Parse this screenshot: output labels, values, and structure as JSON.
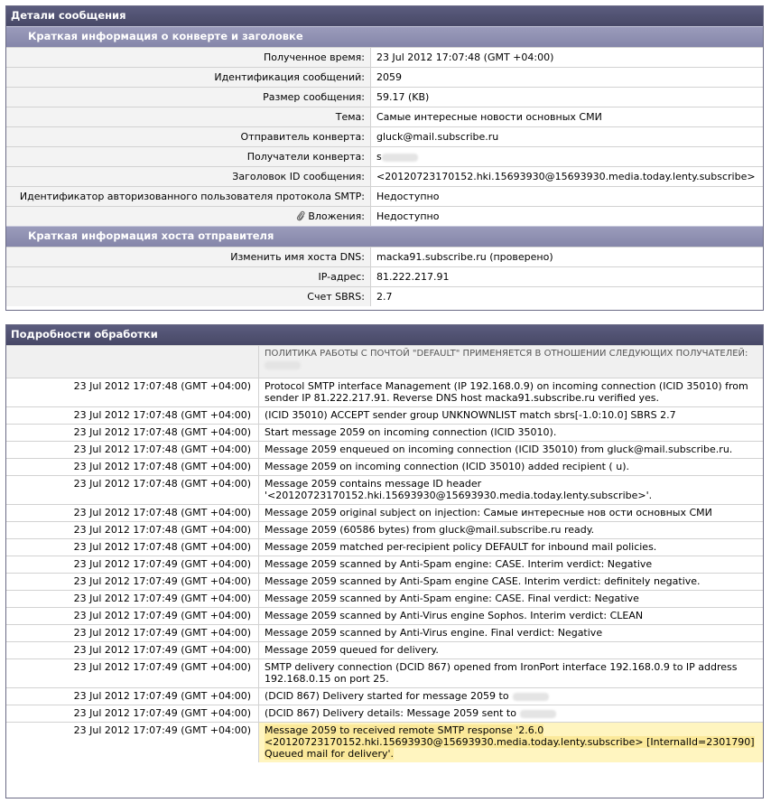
{
  "details": {
    "title": "Детали сообщения",
    "envelope_section": "Краткая информация о конверте и заголовке",
    "envelope_rows": [
      {
        "key": "Полученное время:",
        "value": "23 Jul 2012 17:07:48 (GMT +04:00)"
      },
      {
        "key": "Идентификация сообщений:",
        "value": "2059"
      },
      {
        "key": "Размер сообщения:",
        "value": "59.17 (KB)"
      },
      {
        "key": "Тема:",
        "value": "Самые интересные новости основных СМИ"
      },
      {
        "key": "Отправитель конверта:",
        "value": "gluck@mail.subscribe.ru"
      },
      {
        "key": "Получатели конверта:",
        "value": "s"
      },
      {
        "key": "Заголовок ID сообщения:",
        "value": "<20120723170152.hki.15693930@15693930.media.today.lenty.subscribe>"
      },
      {
        "key": "Идентификатор авторизованного пользователя протокола SMTP:",
        "value": "Недоступно"
      },
      {
        "key": "Вложения:",
        "value": "Недоступно"
      }
    ],
    "sender_section": "Краткая информация хоста отправителя",
    "sender_rows": [
      {
        "key": "Изменить имя хоста DNS:",
        "value": "macka91.subscribe.ru (проверено)"
      },
      {
        "key": "IP-адрес:",
        "value": "81.222.217.91"
      },
      {
        "key": "Счет SBRS:",
        "value": "2.7"
      }
    ]
  },
  "processing": {
    "title": "Подробности обработки",
    "policy_header": "ПОЛИТИКА РАБОТЫ С ПОЧТОЙ \"DEFAULT\" ПРИМЕНЯЕТСЯ В ОТНОШЕНИИ СЛЕДУЮЩИХ ПОЛУЧАТЕЛЕЙ:",
    "log": [
      {
        "time": "23 Jul 2012 17:07:48 (GMT +04:00)",
        "msg": "Protocol SMTP interface Management (IP 192.168.0.9) on incoming connection (ICID 35010) from sender IP 81.222.217.91. Reverse DNS host macka91.subscribe.ru verified yes."
      },
      {
        "time": "23 Jul 2012 17:07:48 (GMT +04:00)",
        "msg": "(ICID 35010) ACCEPT sender group UNKNOWNLIST match sbrs[-1.0:10.0] SBRS 2.7"
      },
      {
        "time": "23 Jul 2012 17:07:48 (GMT +04:00)",
        "msg": "Start message 2059 on incoming connection (ICID 35010)."
      },
      {
        "time": "23 Jul 2012 17:07:48 (GMT +04:00)",
        "msg": "Message 2059 enqueued on incoming connection (ICID 35010) from gluck@mail.subscribe.ru."
      },
      {
        "time": "23 Jul 2012 17:07:48 (GMT +04:00)",
        "msg": "Message 2059 on incoming connection (ICID 35010) added recipient (            u)."
      },
      {
        "time": "23 Jul 2012 17:07:48 (GMT +04:00)",
        "msg": "Message 2059 contains message ID header '<20120723170152.hki.15693930@15693930.media.today.lenty.subscribe>'."
      },
      {
        "time": "23 Jul 2012 17:07:48 (GMT +04:00)",
        "msg": "Message 2059 original subject on injection: Самые интересные нов ости основных СМИ"
      },
      {
        "time": "23 Jul 2012 17:07:48 (GMT +04:00)",
        "msg": "Message 2059 (60586 bytes) from gluck@mail.subscribe.ru ready."
      },
      {
        "time": "23 Jul 2012 17:07:48 (GMT +04:00)",
        "msg": "Message 2059 matched per-recipient policy DEFAULT for inbound mail policies."
      },
      {
        "time": "23 Jul 2012 17:07:49 (GMT +04:00)",
        "msg": "Message 2059 scanned by Anti-Spam engine: CASE. Interim verdict: Negative"
      },
      {
        "time": "23 Jul 2012 17:07:49 (GMT +04:00)",
        "msg": "Message 2059 scanned by Anti-Spam engine CASE. Interim verdict: definitely negative."
      },
      {
        "time": "23 Jul 2012 17:07:49 (GMT +04:00)",
        "msg": "Message 2059 scanned by Anti-Spam engine: CASE. Final verdict: Negative"
      },
      {
        "time": "23 Jul 2012 17:07:49 (GMT +04:00)",
        "msg": "Message 2059 scanned by Anti-Virus engine Sophos. Interim verdict: CLEAN"
      },
      {
        "time": "23 Jul 2012 17:07:49 (GMT +04:00)",
        "msg": "Message 2059 scanned by Anti-Virus engine. Final verdict: Negative"
      },
      {
        "time": "23 Jul 2012 17:07:49 (GMT +04:00)",
        "msg": "Message 2059 queued for delivery."
      },
      {
        "time": "23 Jul 2012 17:07:49 (GMT +04:00)",
        "msg": "SMTP delivery connection (DCID 867) opened from IronPort interface 192.168.0.9 to IP address 192.168.0.15 on port 25."
      },
      {
        "time": "23 Jul 2012 17:07:49 (GMT +04:00)",
        "msg": "(DCID 867) Delivery started for message 2059 to"
      },
      {
        "time": "23 Jul 2012 17:07:49 (GMT +04:00)",
        "msg": "(DCID 867) Delivery details: Message 2059 sent to"
      },
      {
        "time": "23 Jul 2012 17:07:49 (GMT +04:00)",
        "msg": "Message 2059 to          received remote SMTP response '2.6.0 <20120723170152.hki.15693930@15693930.media.today.lenty.subscribe> [InternalId=2301790] Queued mail for delivery'."
      }
    ]
  }
}
